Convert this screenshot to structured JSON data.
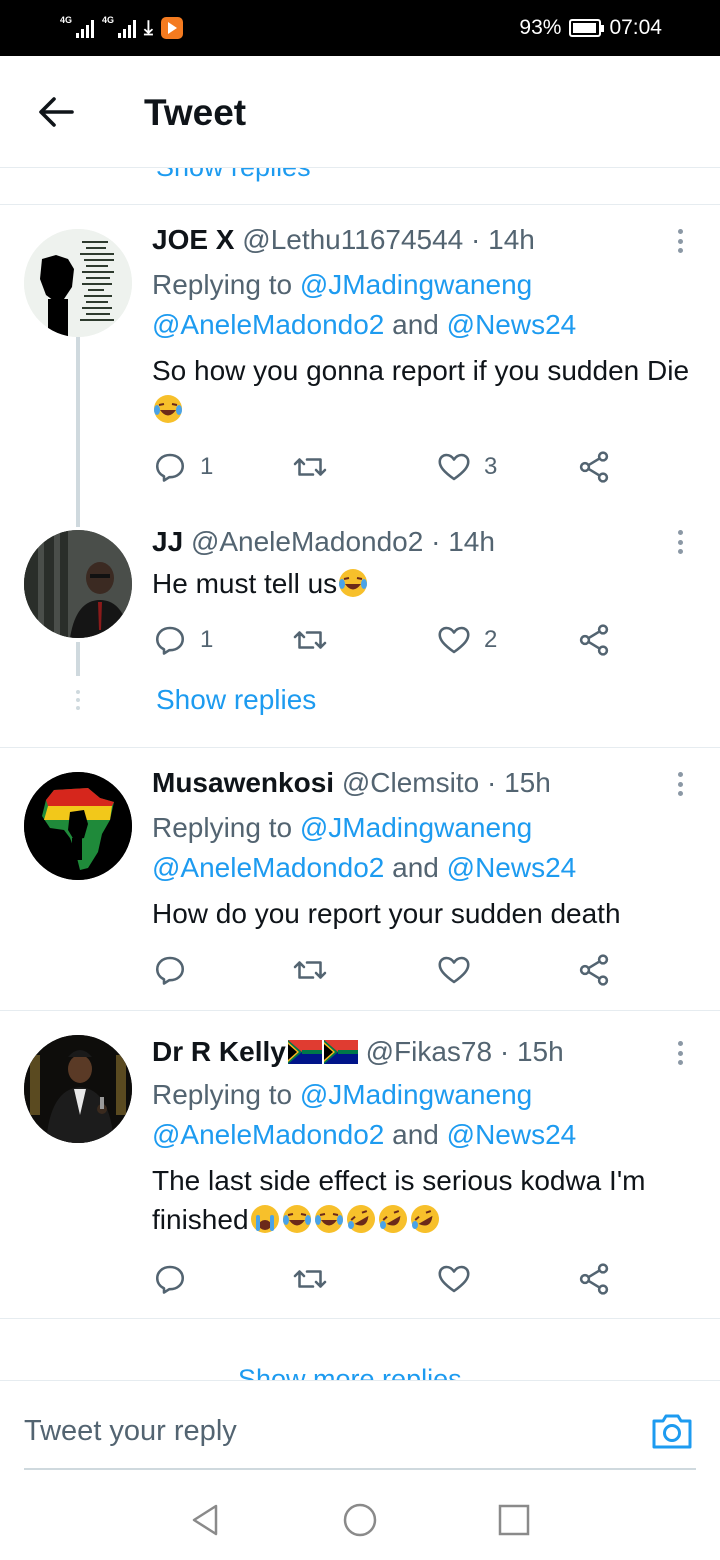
{
  "status_bar": {
    "network_1": "4G",
    "network_2": "4G",
    "battery": "93%",
    "time": "07:04"
  },
  "header": {
    "title": "Tweet"
  },
  "peek_top": "Show replies",
  "tweets": [
    {
      "name": "JOE X",
      "handle": "@Lethu11674544",
      "time": "· 14h",
      "replying_prefix": "Replying to ",
      "replying_1": "@JMadingwaneng",
      "replying_2": "@AneleMadondo2",
      "replying_and": " and ",
      "replying_3": "@News24",
      "text": "So how you gonna report if you sudden Die",
      "replies": "1",
      "likes": "3"
    },
    {
      "name": "JJ",
      "handle": "@AneleMadondo2",
      "time": "· 14h",
      "text": "He must tell us",
      "replies": "1",
      "likes": "2",
      "show_replies": "Show replies"
    },
    {
      "name": "Musawenkosi",
      "handle": "@Clemsito",
      "time": "· 15h",
      "replying_prefix": "Replying to ",
      "replying_1": "@JMadingwaneng",
      "replying_2": "@AneleMadondo2",
      "replying_and": " and ",
      "replying_3": "@News24",
      "text": "How do you report your sudden death"
    },
    {
      "name": "Dr R Kelly",
      "handle": "@Fikas78",
      "time": "· 15h",
      "replying_prefix": "Replying to ",
      "replying_1": "@JMadingwaneng",
      "replying_2": "@AneleMadondo2",
      "replying_and": " and ",
      "replying_3": "@News24",
      "text_1": "The last side effect is serious kodwa I'm",
      "text_2": "finished"
    }
  ],
  "show_more_replies": "Show more replies",
  "composer": {
    "placeholder": "Tweet your reply"
  },
  "colors": {
    "accent": "#1d9bf0",
    "secondary_text": "#536471",
    "divider": "#e6ecf0"
  }
}
